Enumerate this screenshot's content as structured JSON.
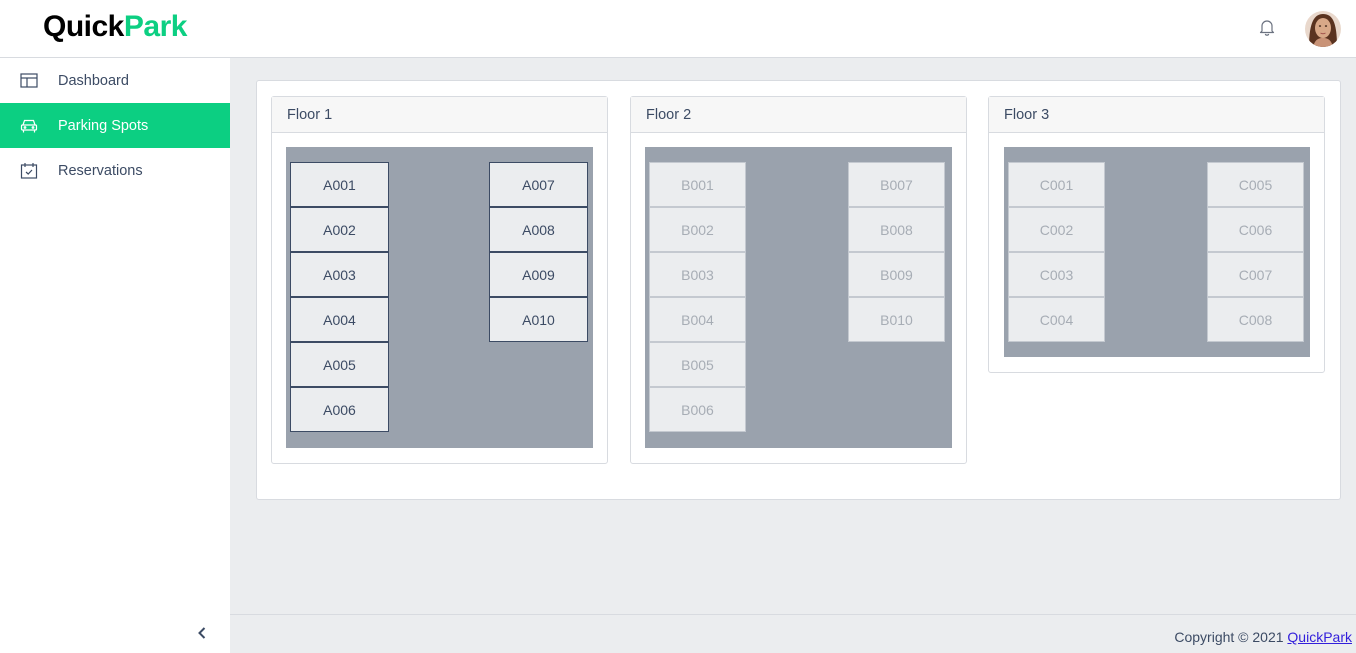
{
  "header": {
    "logo_part1": "Quick",
    "logo_part2": "Park",
    "notification_icon": "bell-icon",
    "avatar_icon": "user-avatar"
  },
  "sidebar": {
    "items": [
      {
        "label": "Dashboard",
        "icon": "dashboard-icon",
        "active": false
      },
      {
        "label": "Parking Spots",
        "icon": "car-icon",
        "active": true
      },
      {
        "label": "Reservations",
        "icon": "calendar-check-icon",
        "active": false
      }
    ],
    "collapse_icon": "chevron-left-icon"
  },
  "floors": [
    {
      "title": "Floor 1",
      "left_column": [
        "A001",
        "A002",
        "A003",
        "A004",
        "A005",
        "A006"
      ],
      "right_column": [
        "A007",
        "A008",
        "A009",
        "A010"
      ],
      "available": true
    },
    {
      "title": "Floor 2",
      "left_column": [
        "B001",
        "B002",
        "B003",
        "B004",
        "B005",
        "B006"
      ],
      "right_column": [
        "B007",
        "B008",
        "B009",
        "B010"
      ],
      "available": false
    },
    {
      "title": "Floor 3",
      "left_column": [
        "C001",
        "C002",
        "C003",
        "C004"
      ],
      "right_column": [
        "C005",
        "C006",
        "C007",
        "C008"
      ],
      "available": false
    }
  ],
  "footer": {
    "copyright": "Copyright © 2021",
    "link": "QuickPark"
  },
  "colors": {
    "brand": "#0ccf82",
    "text": "#3c4b64",
    "lot": "#9aa2ad",
    "link": "#321fdb"
  }
}
